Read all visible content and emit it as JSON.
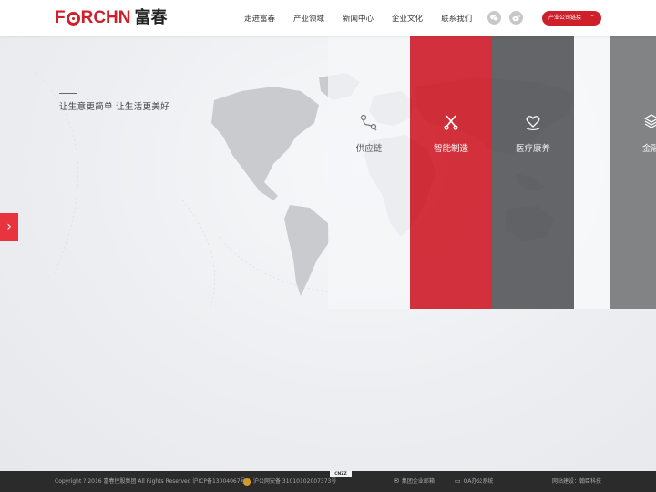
{
  "header": {
    "logo_en": "FORCHN",
    "logo_cn": "富春",
    "nav": [
      "走进富春",
      "产业领域",
      "新闻中心",
      "企业文化",
      "联系我们"
    ],
    "industry_link_label": "产业公司链接"
  },
  "hero": {
    "tagline": "让生意更简单 让生活更美好",
    "sectors": [
      {
        "label": "供应链",
        "icon": "supply-chain-route-icon"
      },
      {
        "label": "智能制造",
        "icon": "tools-cross-icon"
      },
      {
        "label": "医疗康养",
        "icon": "heart-hands-icon"
      },
      {
        "label": "金融",
        "icon": "layers-stack-icon"
      }
    ]
  },
  "footer": {
    "copyright": "Copyright ? 2016 富春控股集团 All Rights Reserved 沪ICP备13004067号-1",
    "police": "沪公网安备 31010102007373号",
    "cnzz": "CNZZ",
    "mail": "集团企业邮箱",
    "oa": "OA办公系统",
    "build": "网站建设：翰臣科技"
  },
  "colors": {
    "brand_red": "#cf1f2b",
    "panel_dark": "#58595c",
    "footer_bg": "#2b2b2b"
  }
}
